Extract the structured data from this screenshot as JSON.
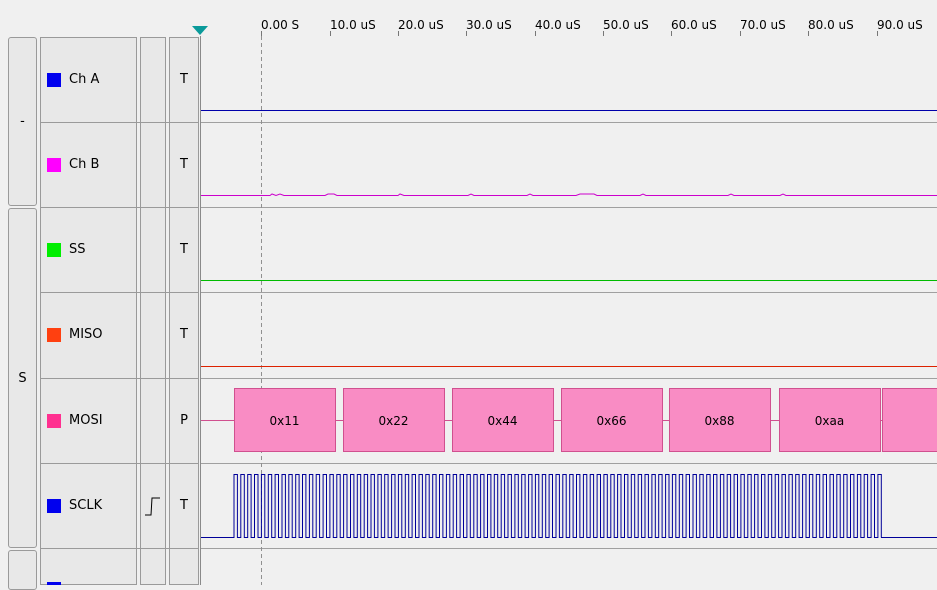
{
  "ruler": {
    "ticks": [
      "0.00  S",
      "10.0 uS",
      "20.0 uS",
      "30.0 uS",
      "40.0 uS",
      "50.0 uS",
      "60.0 uS",
      "70.0 uS",
      "80.0 uS",
      "90.0 uS"
    ]
  },
  "groups": [
    {
      "label": "-"
    },
    {
      "label": "S"
    }
  ],
  "channels": [
    {
      "name": "Ch A",
      "color": "#0000ee",
      "type": "T"
    },
    {
      "name": "Ch B",
      "color": "#ff00ff",
      "type": "T"
    },
    {
      "name": "SS",
      "color": "#00ee00",
      "type": "T"
    },
    {
      "name": "MISO",
      "color": "#ff4010",
      "type": "T"
    },
    {
      "name": "MOSI",
      "color": "#ff3090",
      "type": "P"
    },
    {
      "name": "SCLK",
      "color": "#0000ee",
      "type": "T",
      "edge": "rising-edge-icon"
    }
  ],
  "mosi_packets": [
    "0x11",
    "0x22",
    "0x44",
    "0x66",
    "0x88",
    "0xaa"
  ],
  "colors": {
    "packet_fill": "#f98cc4",
    "packet_border": "#d0508f",
    "ch_a": "#0000aa",
    "ch_b": "#cc00cc",
    "ss": "#00bb00",
    "miso": "#dd2200",
    "sclk": "#000099"
  }
}
